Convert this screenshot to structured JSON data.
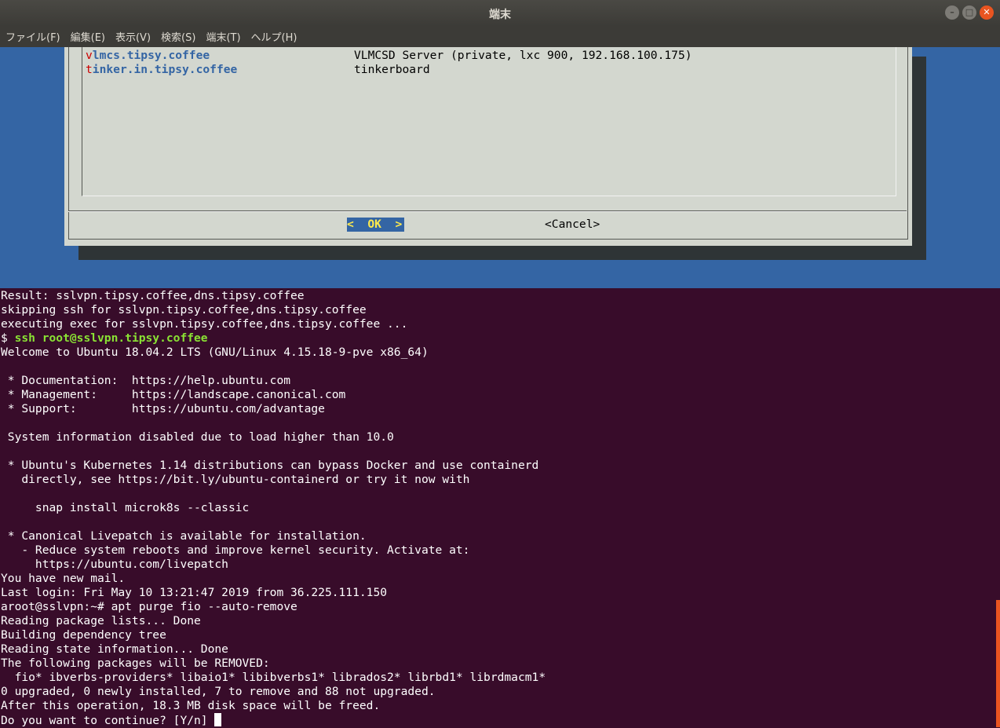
{
  "window": {
    "title": "端末"
  },
  "menu": [
    {
      "label": "ファイル(F)"
    },
    {
      "label": "編集(E)"
    },
    {
      "label": "表示(V)"
    },
    {
      "label": "検索(S)"
    },
    {
      "label": "端末(T)"
    },
    {
      "label": "ヘルプ(H)"
    }
  ],
  "dialog": {
    "rows": [
      {
        "hotkey": "v",
        "rest": "lmcs.tipsy.coffee",
        "desc": "VLMCSD Server (private, lxc 900, 192.168.100.175)"
      },
      {
        "hotkey": "t",
        "rest": "inker.in.tipsy.coffee",
        "desc": "tinkerboard"
      }
    ],
    "ok_label": "<  OK  >",
    "cancel_label": "<Cancel>"
  },
  "terminal": {
    "lines": [
      "Result: sslvpn.tipsy.coffee,dns.tipsy.coffee",
      "skipping ssh for sslvpn.tipsy.coffee,dns.tipsy.coffee",
      "executing exec for sslvpn.tipsy.coffee,dns.tipsy.coffee ...",
      "",
      "Welcome to Ubuntu 18.04.2 LTS (GNU/Linux 4.15.18-9-pve x86_64)",
      "",
      " * Documentation:  https://help.ubuntu.com",
      " * Management:     https://landscape.canonical.com",
      " * Support:        https://ubuntu.com/advantage",
      "",
      " System information disabled due to load higher than 10.0",
      "",
      " * Ubuntu's Kubernetes 1.14 distributions can bypass Docker and use containerd",
      "   directly, see https://bit.ly/ubuntu-containerd or try it now with",
      "",
      "     snap install microk8s --classic",
      "",
      " * Canonical Livepatch is available for installation.",
      "   - Reduce system reboots and improve kernel security. Activate at:",
      "     https://ubuntu.com/livepatch",
      "You have new mail.",
      "Last login: Fri May 10 13:21:47 2019 from 36.225.111.150",
      "aroot@sslvpn:~# apt purge fio --auto-remove",
      "Reading package lists... Done",
      "Building dependency tree",
      "Reading state information... Done",
      "The following packages will be REMOVED:",
      "  fio* ibverbs-providers* libaio1* libibverbs1* librados2* librbd1* librdmacm1*",
      "0 upgraded, 0 newly installed, 7 to remove and 88 not upgraded.",
      "After this operation, 18.3 MB disk space will be freed."
    ],
    "ssh_prompt": "$ ",
    "ssh_command": "ssh root@sslvpn.tipsy.coffee",
    "last_prompt": "Do you want to continue? [Y/n] "
  }
}
